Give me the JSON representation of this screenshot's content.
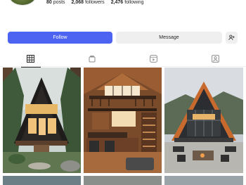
{
  "profile": {
    "stats": {
      "posts": {
        "value": "80",
        "label": "posts"
      },
      "followers": {
        "value": "2,068",
        "label": "followers"
      },
      "following": {
        "value": "2,476",
        "label": "following"
      }
    }
  },
  "actions": {
    "follow_label": "Follow",
    "message_label": "Message",
    "add_user_icon": "add-person-icon"
  },
  "tabs": [
    {
      "icon": "grid-icon",
      "active": true
    },
    {
      "icon": "reels-icon",
      "active": false
    },
    {
      "icon": "video-icon",
      "active": false
    },
    {
      "icon": "tagged-icon",
      "active": false
    }
  ],
  "posts": [
    {
      "subject": "a-frame cabin in forest"
    },
    {
      "subject": "loft cabin interior"
    },
    {
      "subject": "a-frame house patio"
    }
  ],
  "colors": {
    "follow_button": "#4d64f3",
    "secondary_button": "#efefef",
    "text": "#262626"
  }
}
